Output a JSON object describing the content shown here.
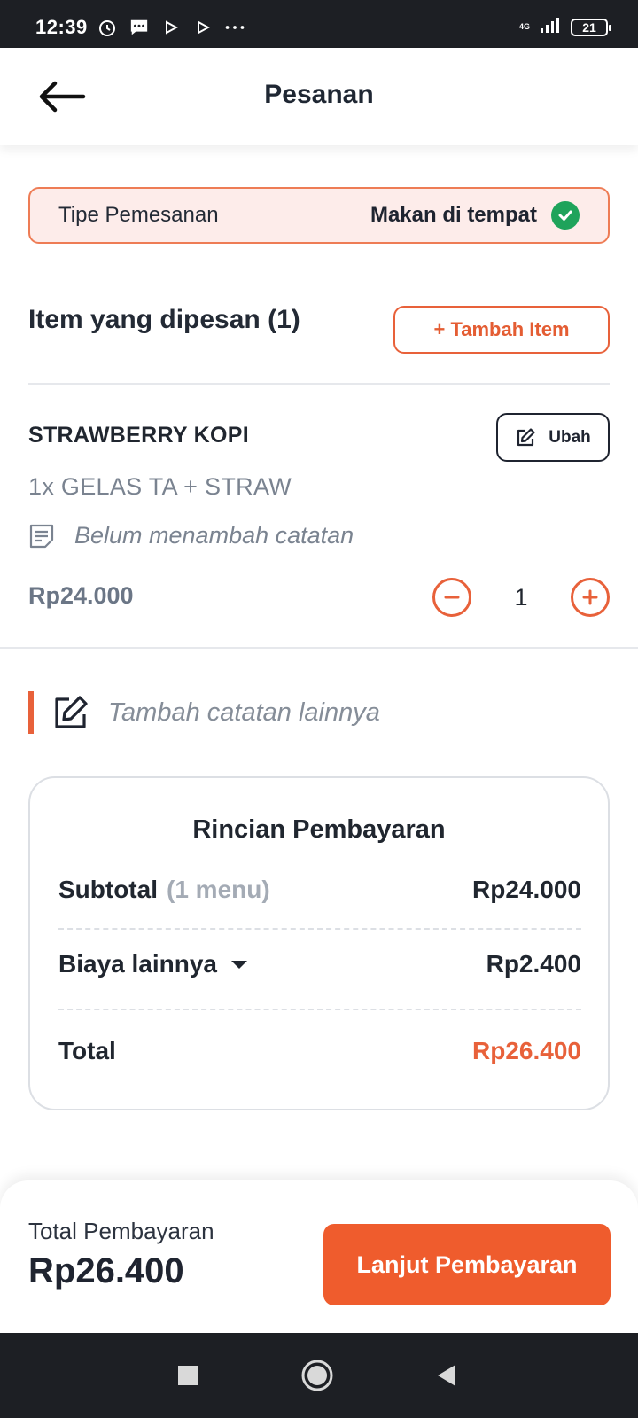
{
  "status_bar": {
    "time": "12:39",
    "network": "4G",
    "battery": "21",
    "icons": [
      "alarm-icon",
      "chat-icon",
      "play-store-icon",
      "play-store-icon",
      "more-dots-icon",
      "signal-icon",
      "battery-icon"
    ]
  },
  "header": {
    "title": "Pesanan",
    "back_icon": "arrow-left-icon"
  },
  "order_type": {
    "label": "Tipe Pemesanan",
    "value": "Makan di tempat",
    "icon": "check-circle-icon",
    "accent_color": "#1fa35b"
  },
  "items_section": {
    "heading": "Item yang dipesan (1)",
    "add_button": "+ Tambah Item"
  },
  "item": {
    "name": "STRAWBERRY KOPI",
    "variant": "1x GELAS TA + STRAW",
    "note": "Belum menambah catatan",
    "price": "Rp24.000",
    "quantity": "1",
    "edit_label": "Ubah"
  },
  "other_note": {
    "placeholder": "Tambah catatan lainnya"
  },
  "payment_details": {
    "title": "Rincian Pembayaran",
    "subtotal_label": "Subtotal",
    "subtotal_count": "(1 menu)",
    "subtotal_value": "Rp24.000",
    "other_fee_label": "Biaya lainnya",
    "other_fee_value": "Rp2.400",
    "total_label": "Total",
    "total_value": "Rp26.400"
  },
  "footer": {
    "total_label": "Total Pembayaran",
    "total_value": "Rp26.400",
    "pay_button": "Lanjut Pembayaran"
  },
  "colors": {
    "accent": "#ef5c2d",
    "success": "#1fa35b",
    "order_type_bg": "#fdecea"
  }
}
